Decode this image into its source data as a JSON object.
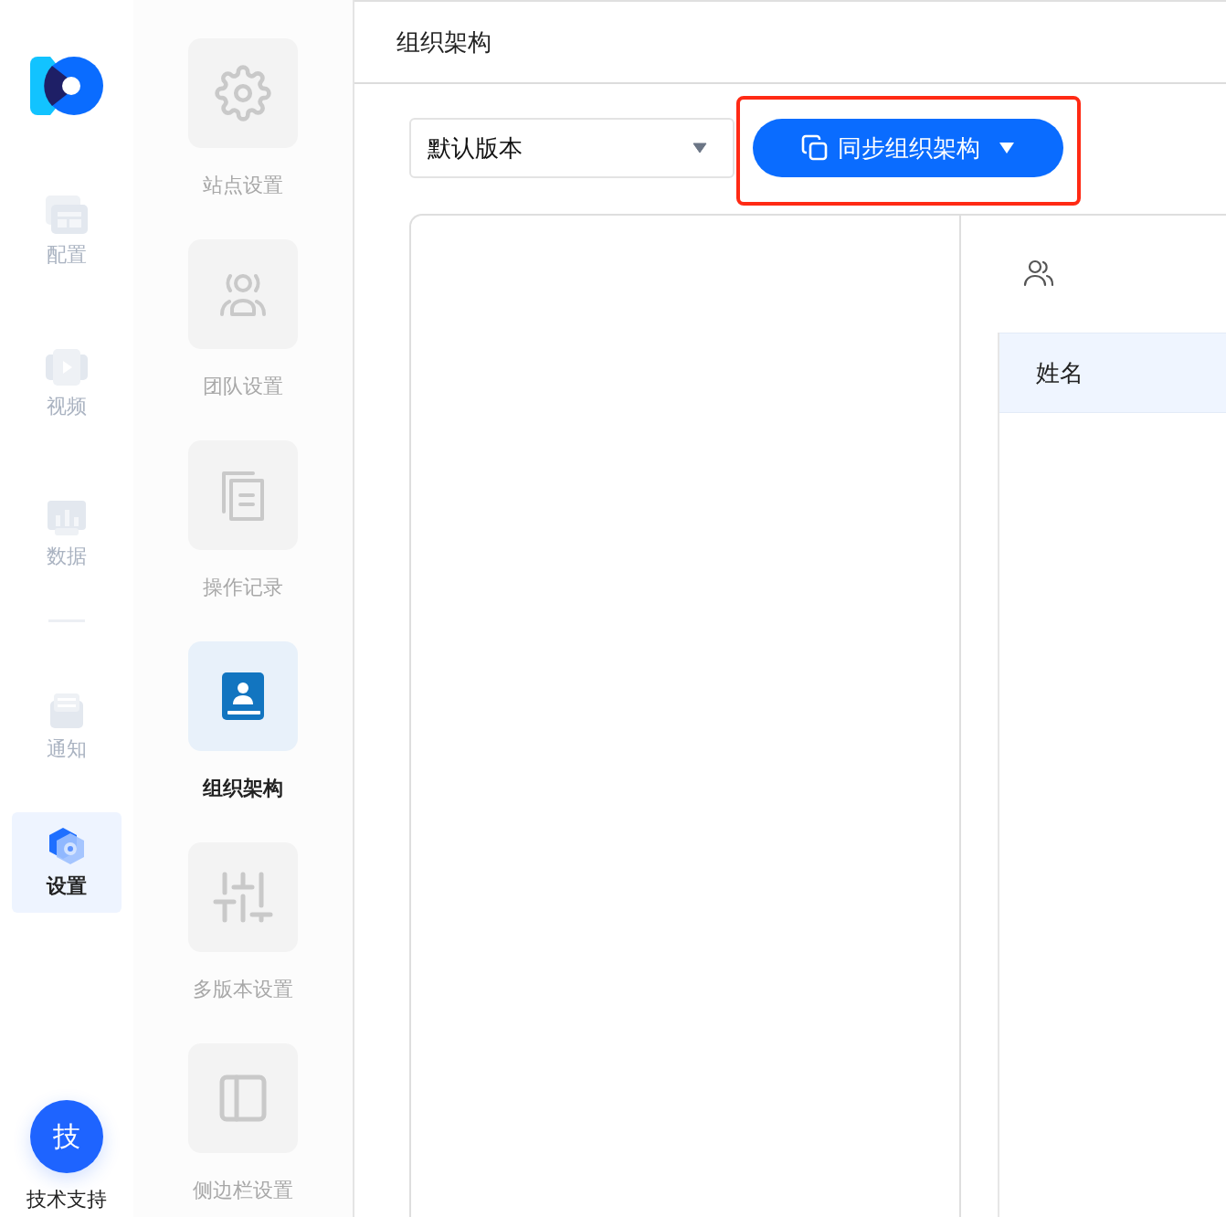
{
  "nav": {
    "items": [
      {
        "label": "配置",
        "selected": false
      },
      {
        "label": "视频",
        "selected": false
      },
      {
        "label": "数据",
        "selected": false
      },
      {
        "label": "通知",
        "selected": false
      },
      {
        "label": "设置",
        "selected": true
      }
    ],
    "support": {
      "badge": "技",
      "label": "技术支持"
    }
  },
  "subnav": {
    "items": [
      {
        "label": "站点设置",
        "selected": false
      },
      {
        "label": "团队设置",
        "selected": false
      },
      {
        "label": "操作记录",
        "selected": false
      },
      {
        "label": "组织架构",
        "selected": true
      },
      {
        "label": "多版本设置",
        "selected": false
      },
      {
        "label": "侧边栏设置",
        "selected": false
      }
    ]
  },
  "header": {
    "title": "组织架构"
  },
  "toolbar": {
    "version_select": {
      "value": "默认版本"
    },
    "sync_button": {
      "label": "同步组织架构"
    }
  },
  "table": {
    "columns": [
      "姓名"
    ]
  }
}
